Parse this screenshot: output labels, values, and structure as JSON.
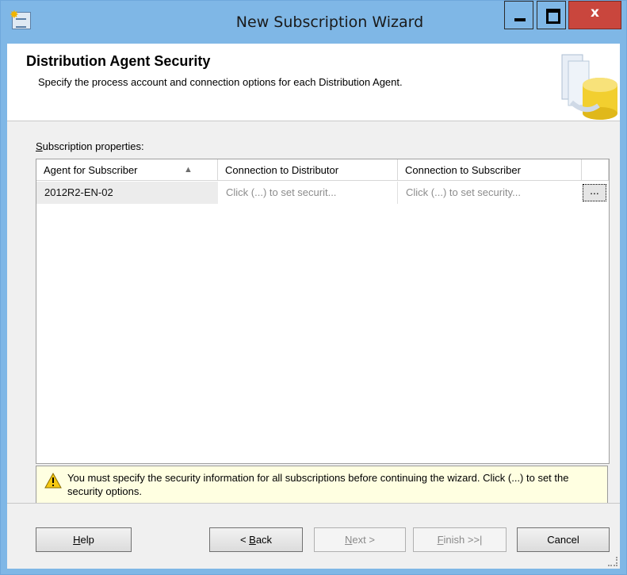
{
  "window": {
    "title": "New Subscription Wizard",
    "close_glyph": "x"
  },
  "header": {
    "title": "Distribution Agent Security",
    "subtitle": "Specify the process account and connection options for each Distribution Agent."
  },
  "subscription": {
    "label_mnemonic": "S",
    "label_rest": "ubscription properties:",
    "columns": [
      "Agent for Subscriber",
      "Connection to Distributor",
      "Connection to Subscriber"
    ],
    "sort_indicator": "▲",
    "rows": [
      {
        "agent": "2012R2-EN-02",
        "distributor": "Click (...) to set securit...",
        "subscriber": "Click (...) to set security...",
        "ellipsis": "..."
      }
    ]
  },
  "warning": {
    "text": "You must specify the security information for all subscriptions before continuing the wizard. Click (...) to set the security options."
  },
  "buttons": {
    "help_mnemonic": "H",
    "help_rest": "elp",
    "back_prefix": "< ",
    "back_mnemonic": "B",
    "back_rest": "ack",
    "next_mnemonic": "N",
    "next_rest": "ext >",
    "finish_mnemonic": "F",
    "finish_rest": "inish >>|",
    "cancel": "Cancel"
  },
  "icons": {
    "app": "wizard-app-icon",
    "header": "database-agent-graphic",
    "warning": "warning-icon",
    "minimize": "minimize-icon",
    "maximize": "maximize-icon",
    "close": "close-icon"
  },
  "colors": {
    "titlebar": "#7fb7e6",
    "close_button": "#c9463d",
    "warning_background": "#ffffe1"
  }
}
